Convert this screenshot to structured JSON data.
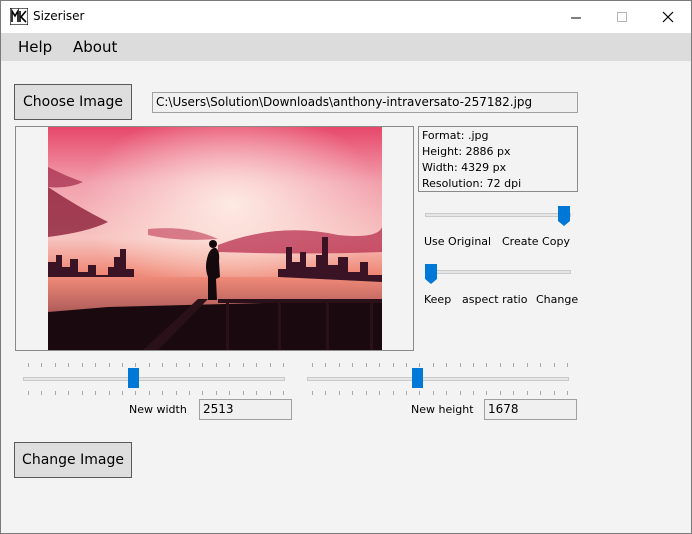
{
  "window": {
    "title": "Sizeriser",
    "icon": "app-logo-icon"
  },
  "menu": {
    "help": "Help",
    "about": "About"
  },
  "choose_button": "Choose Image",
  "file_path": "C:\\Users\\Solution\\Downloads\\anthony-intraversato-257182.jpg",
  "info": {
    "format": "Format: .jpg",
    "height": "Height: 2886 px",
    "width": "Width: 4329 px",
    "resolution": "Resolution: 72 dpi"
  },
  "copy_slider": {
    "left_label": "Use Original",
    "right_label": "Create Copy",
    "value": 1
  },
  "aspect_slider": {
    "left_label": "Keep",
    "middle_label": "aspect ratio",
    "right_label": "Change",
    "value": 0
  },
  "width_slider": {
    "label": "New width",
    "value": "2513",
    "fraction": 0.42
  },
  "height_slider": {
    "label": "New height",
    "value": "1678",
    "fraction": 0.42
  },
  "change_button": "Change Image",
  "colors": {
    "accent": "#0078d7",
    "menubar": "#dcdcdc",
    "background": "#f3f3f3"
  }
}
